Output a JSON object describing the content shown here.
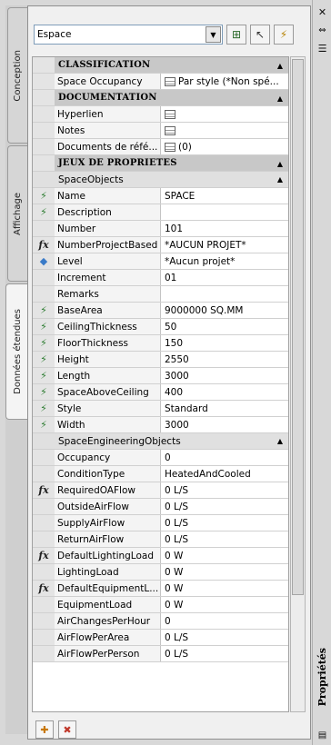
{
  "tabs": [
    {
      "label": "Conception",
      "active": false
    },
    {
      "label": "Affichage",
      "active": false
    },
    {
      "label": "Données étendues",
      "active": true
    }
  ],
  "object_select": {
    "value": "Espace"
  },
  "categories": {
    "classification": "CLASSIFICATION",
    "documentation": "DOCUMENTATION",
    "property_sets": "JEUX DE PROPRIETES"
  },
  "classification": {
    "space_occupancy_label": "Space Occupancy",
    "space_occupancy_value": "Par style (*Non spé..."
  },
  "documentation": {
    "hyperlink_label": "Hyperlien",
    "notes_label": "Notes",
    "reference_docs_label": "Documents de réfé...",
    "reference_docs_value": "(0)"
  },
  "space_objects": {
    "title": "SpaceObjects",
    "rows": [
      {
        "name": "Name",
        "value": "SPACE",
        "icon": "green-sparkle"
      },
      {
        "name": "Description",
        "value": "",
        "icon": "green-sparkle"
      },
      {
        "name": "Number",
        "value": "101",
        "icon": ""
      },
      {
        "name": "NumberProjectBased",
        "value": "*AUCUN PROJET*",
        "icon": "formula"
      },
      {
        "name": "Level",
        "value": "*Aucun projet*",
        "icon": "level"
      },
      {
        "name": "Increment",
        "value": "01",
        "icon": ""
      },
      {
        "name": "Remarks",
        "value": "",
        "icon": ""
      },
      {
        "name": "BaseArea",
        "value": "9000000 SQ.MM",
        "icon": "green-sparkle"
      },
      {
        "name": "CeilingThickness",
        "value": "50",
        "icon": "green-sparkle"
      },
      {
        "name": "FloorThickness",
        "value": "150",
        "icon": "green-sparkle"
      },
      {
        "name": "Height",
        "value": "2550",
        "icon": "green-sparkle"
      },
      {
        "name": "Length",
        "value": "3000",
        "icon": "green-sparkle"
      },
      {
        "name": "SpaceAboveCeiling",
        "value": "400",
        "icon": "green-sparkle"
      },
      {
        "name": "Style",
        "value": "Standard",
        "icon": "green-sparkle"
      },
      {
        "name": "Width",
        "value": "3000",
        "icon": "green-sparkle"
      }
    ]
  },
  "space_engineering": {
    "title": "SpaceEngineeringObjects",
    "rows": [
      {
        "name": "Occupancy",
        "value": "0",
        "icon": ""
      },
      {
        "name": "ConditionType",
        "value": "HeatedAndCooled",
        "icon": ""
      },
      {
        "name": "RequiredOAFlow",
        "value": "0 L/S",
        "icon": "formula"
      },
      {
        "name": "OutsideAirFlow",
        "value": "0 L/S",
        "icon": ""
      },
      {
        "name": "SupplyAirFlow",
        "value": "0 L/S",
        "icon": ""
      },
      {
        "name": "ReturnAirFlow",
        "value": "0 L/S",
        "icon": ""
      },
      {
        "name": "DefaultLightingLoad",
        "value": "0 W",
        "icon": "formula"
      },
      {
        "name": "LightingLoad",
        "value": "0 W",
        "icon": ""
      },
      {
        "name": "DefaultEquipmentL...",
        "value": "0 W",
        "icon": "formula"
      },
      {
        "name": "EquipmentLoad",
        "value": "0 W",
        "icon": ""
      },
      {
        "name": "AirChangesPerHour",
        "value": "0",
        "icon": ""
      },
      {
        "name": "AirFlowPerArea",
        "value": "0 L/S",
        "icon": ""
      },
      {
        "name": "AirFlowPerPerson",
        "value": "0 L/S",
        "icon": ""
      }
    ]
  },
  "palette_title": "Propriétés"
}
